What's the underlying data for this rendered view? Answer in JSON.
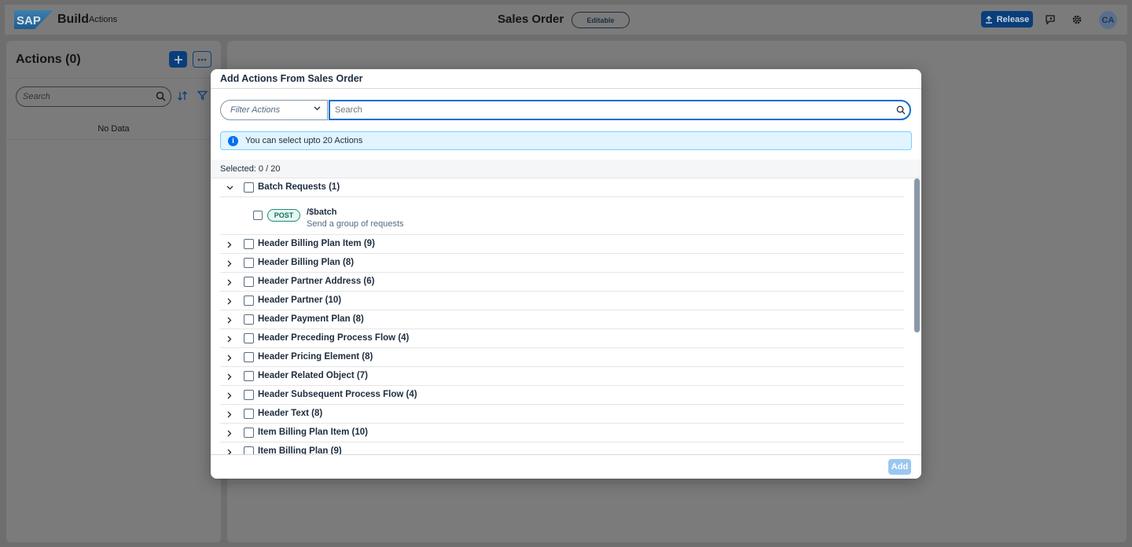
{
  "shell": {
    "brand": "Build",
    "brand_sub": "Actions",
    "center_title": "Sales Order",
    "status_badge": "Editable",
    "release_label": "Release",
    "avatar_initials": "CA"
  },
  "left_panel": {
    "title": "Actions (0)",
    "search_placeholder": "Search",
    "empty_text": "No Data"
  },
  "dialog": {
    "title": "Add Actions From Sales Order",
    "filter_placeholder": "Filter Actions",
    "search_placeholder": "Search",
    "info_text": "You can select upto 20 Actions",
    "selected_text": "Selected: 0 / 20",
    "groups": [
      {
        "label": "Batch Requests (1)",
        "expanded": true
      },
      {
        "label": "Header Billing Plan Item (9)"
      },
      {
        "label": "Header Billing Plan (8)"
      },
      {
        "label": "Header Partner Address (6)"
      },
      {
        "label": "Header Partner (10)"
      },
      {
        "label": "Header Payment Plan (8)"
      },
      {
        "label": "Header Preceding Process Flow (4)"
      },
      {
        "label": "Header Pricing Element (8)"
      },
      {
        "label": "Header Related Object (7)"
      },
      {
        "label": "Header Subsequent Process Flow (4)"
      },
      {
        "label": "Header Text (8)"
      },
      {
        "label": "Item Billing Plan Item (10)"
      },
      {
        "label": "Item Billing Plan (9)"
      }
    ],
    "batch_item": {
      "method": "POST",
      "path": "/$batch",
      "description": "Send a group of requests"
    },
    "add_label": "Add"
  },
  "colors": {
    "accent": "#0a6ed1",
    "shell_primary": "#0a3e7a",
    "info_bg": "#e1f4ff",
    "post_badge": "#1b8e73"
  }
}
